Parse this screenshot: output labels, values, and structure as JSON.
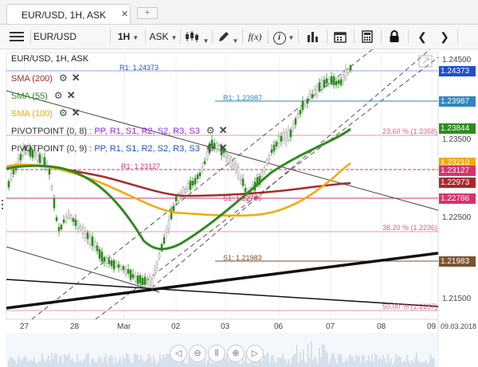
{
  "tab": {
    "title": "EUR/USD, 1H, ASK",
    "close_icon": "✕",
    "add_label": "+"
  },
  "toolbar": {
    "symbol": "EUR/USD",
    "timeframe": "1H",
    "price_type": "ASK",
    "fx_label": "f(x)",
    "info_label": "i",
    "prev_label": "❮",
    "next_label": "❯"
  },
  "chart_header": {
    "title": "EUR/USD, 1H, ASK"
  },
  "indicators": [
    {
      "name": "SMA (200)",
      "color": "#a52a2a"
    },
    {
      "name": "SMA (55)",
      "color": "#2e8b1f"
    },
    {
      "name": "SMA (100)",
      "color": "#f5a800"
    },
    {
      "name": "PIVOTPOINT (0, 8)",
      "params": ": PP, R1, S1, R2, S2, R3, S3",
      "color": "#333333"
    },
    {
      "name": "PIVOTPOINT (0, 9)",
      "params": ": PP, R1, S1, R2, S2, R3, S3",
      "color": "#333333"
    }
  ],
  "price_labels": [
    {
      "text": "1.24373",
      "color": "#1f4fd1"
    },
    {
      "text": "1.23987",
      "color": "#2e86c1"
    },
    {
      "text": "1.23844",
      "color": "#2e8b1f"
    },
    {
      "text": "1.23210",
      "color": "#f5a800"
    },
    {
      "text": "1.23127",
      "color": "#d6336c"
    },
    {
      "text": "1.22973",
      "color": "#a52a2a"
    },
    {
      "text": "1.22786",
      "color": "#d6336c"
    },
    {
      "text": "1.21983",
      "color": "#7a5230"
    }
  ],
  "price_ticks": [
    "1.24500",
    "1.23500",
    "1.22500",
    "1.21500"
  ],
  "annotations": {
    "r1_top": "R1: 1.24373",
    "r1_mid": "R1: 1.23987",
    "r1_low": "R1: 1.23127",
    "s1_pink": "S1: 1.22786",
    "s1_brown": "S1: 1.21983",
    "fib_236": "23.60 % (1.2358)",
    "fib_382": "38.20 % (1.2236)",
    "fib_50": "50.00 % (1.2137)"
  },
  "time_axis": {
    "labels": [
      "27",
      "28",
      "Mar",
      "02",
      "03",
      "06",
      "07",
      "08",
      "09"
    ],
    "date_label": "09.03.2018"
  },
  "zoom_controls": [
    "◁",
    "⊖",
    "⫴",
    "⊕",
    "▷"
  ],
  "colors": {
    "sma200": "#a52a2a",
    "sma55": "#2e8b1f",
    "sma100": "#f5a800",
    "candle_up": "#2e8b1f",
    "candle_down": "#d0d0d0",
    "fib": "#e89aa9",
    "pivot_blue": "#1f4fd1"
  }
}
